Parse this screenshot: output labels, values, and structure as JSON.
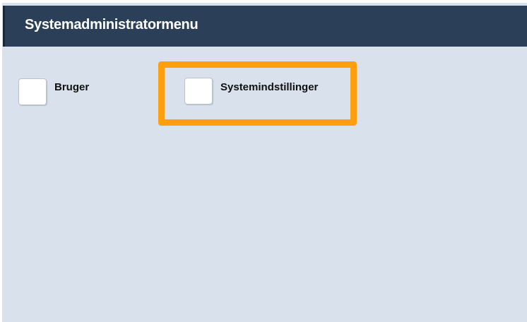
{
  "header": {
    "title": "Systemadministratormenu"
  },
  "options": [
    {
      "label": "Bruger",
      "checked": false
    },
    {
      "label": "Systemindstillinger",
      "checked": false,
      "highlighted": true
    }
  ],
  "colors": {
    "header_bg": "#2b4058",
    "page_bg": "#d9e1ec",
    "highlight": "#ff9f0e"
  }
}
